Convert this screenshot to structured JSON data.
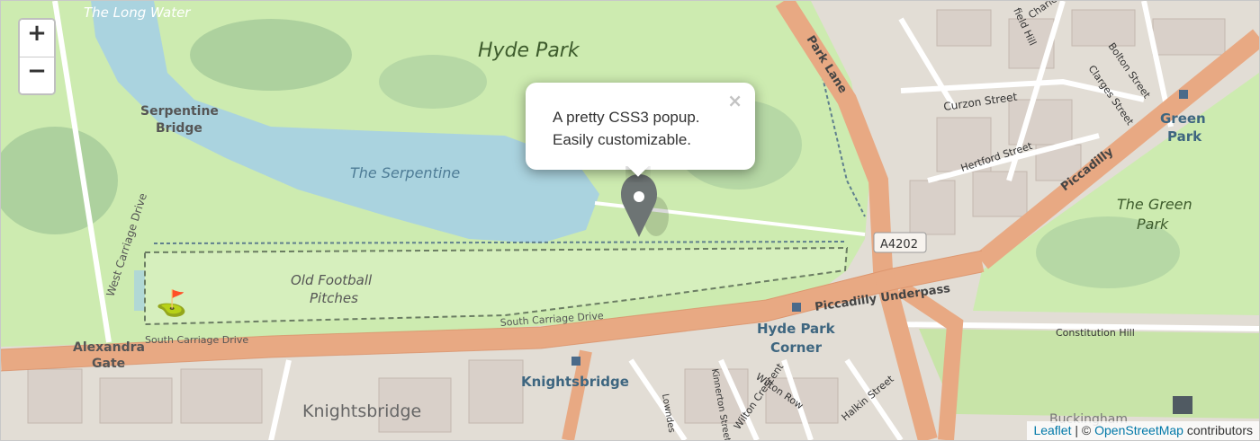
{
  "map": {
    "labels": {
      "hyde_park": "Hyde Park",
      "long_water": "The Long Water",
      "serpentine_bridge_1": "Serpentine",
      "serpentine_bridge_2": "Bridge",
      "the_serpentine": "The Serpentine",
      "old_football_1": "Old Football",
      "old_football_2": "Pitches",
      "west_carriage_drive": "West Carriage Drive",
      "south_carriage_drive_1": "South Carriage Drive",
      "south_carriage_drive_2": "South Carriage Drive",
      "alexandra_gate_1": "Alexandra",
      "alexandra_gate_2": "Gate",
      "knightsbridge_station": "Knightsbridge",
      "knightsbridge_area": "Knightsbridge",
      "hyde_park_corner_1": "Hyde Park",
      "hyde_park_corner_2": "Corner",
      "park_lane": "Park Lane",
      "curzon_street": "Curzon Street",
      "hertford_street": "Hertford Street",
      "piccadilly": "Piccadilly",
      "piccadilly_underpass": "Piccadilly Underpass",
      "a4202": "A4202",
      "green_park_1": "Green",
      "green_park_2": "Park",
      "the_green_park_1": "The Green",
      "the_green_park_2": "Park",
      "constitution_hill": "Constitution Hill",
      "bolton_street": "Bolton Street",
      "clarges_street": "Clarges Street",
      "charles_street": "Charles",
      "hill_street": "field Hill",
      "wilton_row": "Wilton Row",
      "wilton_crescent": "Wilton Crescent",
      "halkin_street": "Halkin Street",
      "kinnerton_street": "Kinnerton Street",
      "lowndes": "Lowndes",
      "buckingham": "Buckingham"
    }
  },
  "zoom": {
    "in_label": "+",
    "out_label": "−"
  },
  "popup": {
    "line1": "A pretty CSS3 popup.",
    "line2": "Easily customizable.",
    "close_label": "×"
  },
  "attribution": {
    "leaflet": "Leaflet",
    "separator": " | © ",
    "osm": "OpenStreetMap",
    "suffix": " contributors"
  },
  "colors": {
    "park": "#cdebb0",
    "water": "#aad3df",
    "major_road": "#e8a983",
    "urban": "#e0dad2",
    "accent_link": "#0078a8"
  }
}
